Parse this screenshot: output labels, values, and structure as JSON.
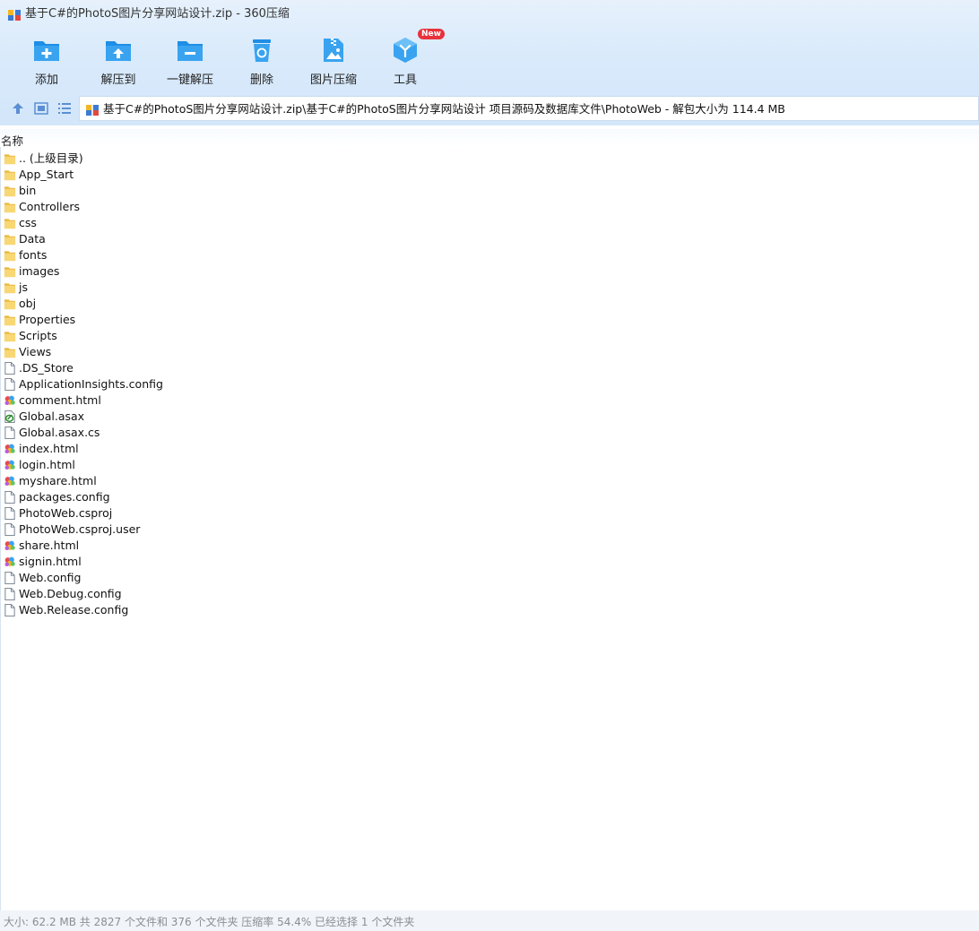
{
  "window": {
    "title": "基于C#的PhotoS图片分享网站设计.zip - 360压缩",
    "app_icon": "archive-icon"
  },
  "toolbar": {
    "buttons": [
      {
        "label": "添加",
        "icon": "add-folder-icon"
      },
      {
        "label": "解压到",
        "icon": "extract-to-folder-icon"
      },
      {
        "label": "一键解压",
        "icon": "one-click-extract-icon"
      },
      {
        "label": "删除",
        "icon": "delete-bin-icon"
      },
      {
        "label": "图片压缩",
        "icon": "image-compress-icon"
      },
      {
        "label": "工具",
        "icon": "tools-cube-icon",
        "badge": "New"
      }
    ]
  },
  "nav": {
    "up_icon": "up-arrow-icon",
    "view_icon": "thumbnail-view-icon",
    "list_icon": "list-view-icon",
    "address": "基于C#的PhotoS图片分享网站设计.zip\\基于C#的PhotoS图片分享网站设计 项目源码及数据库文件\\PhotoWeb - 解包大小为 114.4 MB"
  },
  "list": {
    "column_name": "名称",
    "items": [
      {
        "name": ".. (上级目录)",
        "type": "folder"
      },
      {
        "name": "App_Start",
        "type": "folder"
      },
      {
        "name": "bin",
        "type": "folder"
      },
      {
        "name": "Controllers",
        "type": "folder"
      },
      {
        "name": "css",
        "type": "folder"
      },
      {
        "name": "Data",
        "type": "folder"
      },
      {
        "name": "fonts",
        "type": "folder"
      },
      {
        "name": "images",
        "type": "folder"
      },
      {
        "name": "js",
        "type": "folder"
      },
      {
        "name": "obj",
        "type": "folder"
      },
      {
        "name": "Properties",
        "type": "folder"
      },
      {
        "name": "Scripts",
        "type": "folder"
      },
      {
        "name": "Views",
        "type": "folder"
      },
      {
        "name": ".DS_Store",
        "type": "file"
      },
      {
        "name": "ApplicationInsights.config",
        "type": "file"
      },
      {
        "name": "comment.html",
        "type": "html"
      },
      {
        "name": "Global.asax",
        "type": "asax"
      },
      {
        "name": "Global.asax.cs",
        "type": "file"
      },
      {
        "name": "index.html",
        "type": "html"
      },
      {
        "name": "login.html",
        "type": "html"
      },
      {
        "name": "myshare.html",
        "type": "html"
      },
      {
        "name": "packages.config",
        "type": "file"
      },
      {
        "name": "PhotoWeb.csproj",
        "type": "file"
      },
      {
        "name": "PhotoWeb.csproj.user",
        "type": "file"
      },
      {
        "name": "share.html",
        "type": "html"
      },
      {
        "name": "signin.html",
        "type": "html"
      },
      {
        "name": "Web.config",
        "type": "file"
      },
      {
        "name": "Web.Debug.config",
        "type": "file"
      },
      {
        "name": "Web.Release.config",
        "type": "file"
      }
    ]
  },
  "status": {
    "text": "大小: 62.2 MB 共 2827 个文件和 376 个文件夹 压缩率 54.4% 已经选择 1 个文件夹"
  },
  "colors": {
    "toolbar_bg": "#d9eafb",
    "icon_blue": "#1e8ee6",
    "folder_yellow": "#f8d775",
    "badge_red": "#e8323c"
  }
}
